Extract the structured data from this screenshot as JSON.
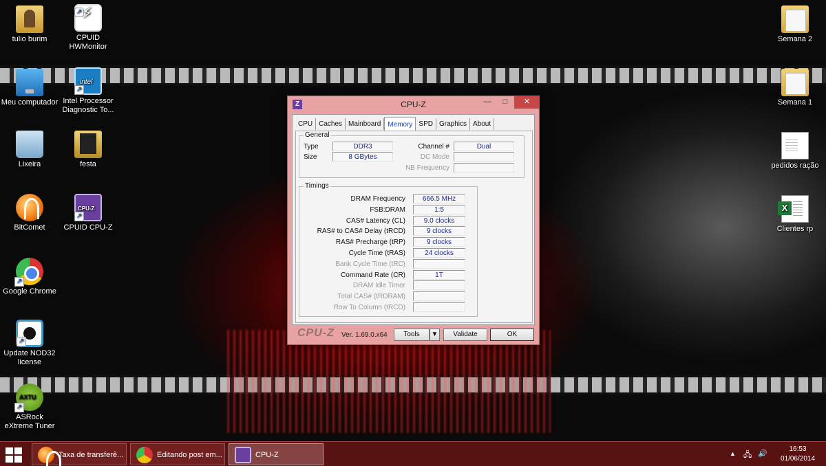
{
  "desktop": {
    "left_icons": [
      {
        "label": "tulio burim",
        "icon": "user-folder-icon"
      },
      {
        "label": "CPUID HWMonitor",
        "icon": "hwmonitor-icon"
      },
      {
        "label": "Meu computador",
        "icon": "computer-icon"
      },
      {
        "label": "Intel Processor Diagnostic To...",
        "icon": "intel-diagnostic-icon"
      },
      {
        "label": "Lixeira",
        "icon": "recycle-bin-icon"
      },
      {
        "label": "festa",
        "icon": "folder-icon"
      },
      {
        "label": "BitComet",
        "icon": "bitcomet-icon"
      },
      {
        "label": "CPUID CPU-Z",
        "icon": "cpuz-icon"
      },
      {
        "label": "Google Chrome",
        "icon": "chrome-icon"
      },
      {
        "label": "Update NOD32 license",
        "icon": "nod32-icon"
      },
      {
        "label": "ASRock eXtreme Tuner",
        "icon": "asrock-icon"
      }
    ],
    "right_icons": [
      {
        "label": "Semana 2",
        "icon": "folder-icon"
      },
      {
        "label": "Semana 1",
        "icon": "folder-icon"
      },
      {
        "label": "pedidos ração",
        "icon": "text-document-icon"
      },
      {
        "label": "Clientes rp",
        "icon": "excel-file-icon"
      }
    ]
  },
  "window": {
    "title": "CPU-Z",
    "app_icon_letter": "Z",
    "controls": {
      "minimize": "—",
      "maximize": "□",
      "close": "✕"
    },
    "tabs": [
      {
        "label": "CPU"
      },
      {
        "label": "Caches"
      },
      {
        "label": "Mainboard"
      },
      {
        "label": "Memory"
      },
      {
        "label": "SPD"
      },
      {
        "label": "Graphics"
      },
      {
        "label": "About"
      }
    ],
    "active_tab": "Memory",
    "general": {
      "legend": "General",
      "type_label": "Type",
      "type_value": "DDR3",
      "size_label": "Size",
      "size_value": "8 GBytes",
      "channel_label": "Channel #",
      "channel_value": "Dual",
      "dc_mode_label": "DC Mode",
      "dc_mode_value": "",
      "nb_freq_label": "NB Frequency",
      "nb_freq_value": ""
    },
    "timings": {
      "legend": "Timings",
      "rows": [
        {
          "label": "DRAM Frequency",
          "value": "666.5 MHz",
          "enabled": true
        },
        {
          "label": "FSB:DRAM",
          "value": "1:5",
          "enabled": true
        },
        {
          "label": "CAS# Latency (CL)",
          "value": "9.0 clocks",
          "enabled": true
        },
        {
          "label": "RAS# to CAS# Delay (tRCD)",
          "value": "9 clocks",
          "enabled": true
        },
        {
          "label": "RAS# Precharge (tRP)",
          "value": "9 clocks",
          "enabled": true
        },
        {
          "label": "Cycle Time (tRAS)",
          "value": "24 clocks",
          "enabled": true
        },
        {
          "label": "Bank Cycle Time (tRC)",
          "value": "",
          "enabled": false
        },
        {
          "label": "Command Rate (CR)",
          "value": "1T",
          "enabled": true
        },
        {
          "label": "DRAM Idle Timer",
          "value": "",
          "enabled": false
        },
        {
          "label": "Total CAS# (tRDRAM)",
          "value": "",
          "enabled": false
        },
        {
          "label": "Row To Column (tRCD)",
          "value": "",
          "enabled": false
        }
      ]
    },
    "footer": {
      "logo": "CPU-Z",
      "version": "Ver. 1.69.0.x64",
      "tools_label": "Tools",
      "tools_arrow": "▼",
      "validate_label": "Validate",
      "ok_label": "OK"
    }
  },
  "taskbar": {
    "items": [
      {
        "label": "Taxa de transferê...",
        "icon": "bitcomet-icon"
      },
      {
        "label": "Editando post em...",
        "icon": "chrome-icon"
      },
      {
        "label": "CPU-Z",
        "icon": "cpuz-icon"
      }
    ],
    "tray": {
      "show_hidden": "▲",
      "network": "🖧",
      "volume": "🔊"
    },
    "clock": {
      "time": "16:53",
      "date": "01/06/2014"
    }
  }
}
